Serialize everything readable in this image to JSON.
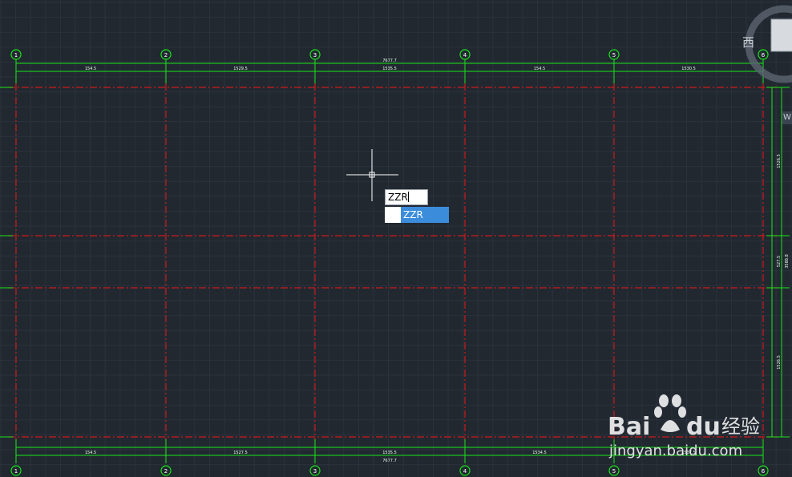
{
  "drawing": {
    "columns": [
      "1",
      "2",
      "3",
      "4",
      "5",
      "6"
    ],
    "top_dimensions": [
      "154.5",
      "1529.5",
      "1535.5",
      "154.5",
      "1530.5"
    ],
    "top_total": "7677.7",
    "bottom_dimensions": [
      "154.5",
      "1527.5",
      "1535.5",
      "1534.5",
      "1537.5"
    ],
    "bottom_total": "7677.7",
    "right_dimensions": [
      "1526.5",
      "527.5",
      "1526.5"
    ],
    "right_total": "3588.8"
  },
  "command": {
    "input_value": "ZZR",
    "suggestion": "ZZR"
  },
  "viewcube": {
    "direction_label": "西",
    "wcs_label": "W"
  },
  "watermark": {
    "brand_left": "Bai",
    "brand_right": "du",
    "brand_cn": "经验",
    "url": "jingyan.baidu.com"
  },
  "colors": {
    "background": "#212830",
    "dimension": "#19e619",
    "axis": "#cc1a1a",
    "grid": "#2d3540"
  }
}
